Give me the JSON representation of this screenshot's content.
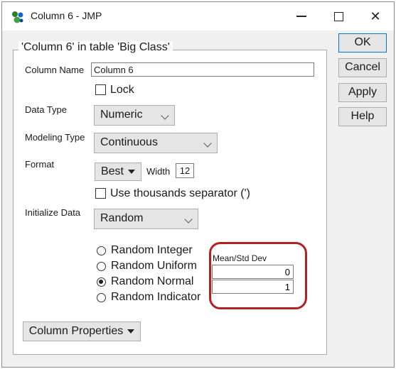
{
  "window": {
    "title": "Column 6 - JMP",
    "icon": "jmp-app-icon"
  },
  "panel": {
    "legend": "'Column 6' in table 'Big Class'"
  },
  "fields": {
    "column_name_label": "Column Name",
    "column_name_value": "Column 6",
    "lock_label": "Lock",
    "data_type_label": "Data Type",
    "data_type_value": "Numeric",
    "modeling_type_label": "Modeling Type",
    "modeling_type_value": "Continuous",
    "format_label": "Format",
    "format_value": "Best",
    "width_label": "Width",
    "width_value": "12",
    "thousands_label": "Use thousands separator (')",
    "initialize_label": "Initialize Data",
    "initialize_value": "Random"
  },
  "random_options": [
    {
      "label": "Random Integer",
      "selected": false
    },
    {
      "label": "Random Uniform",
      "selected": false
    },
    {
      "label": "Random Normal",
      "selected": true
    },
    {
      "label": "Random Indicator",
      "selected": false
    }
  ],
  "mean_std": {
    "label": "Mean/Std Dev",
    "mean": "0",
    "std": "1",
    "highlight_color": "#b22222"
  },
  "buttons": {
    "ok": "OK",
    "cancel": "Cancel",
    "apply": "Apply",
    "help": "Help",
    "column_properties": "Column Properties"
  }
}
